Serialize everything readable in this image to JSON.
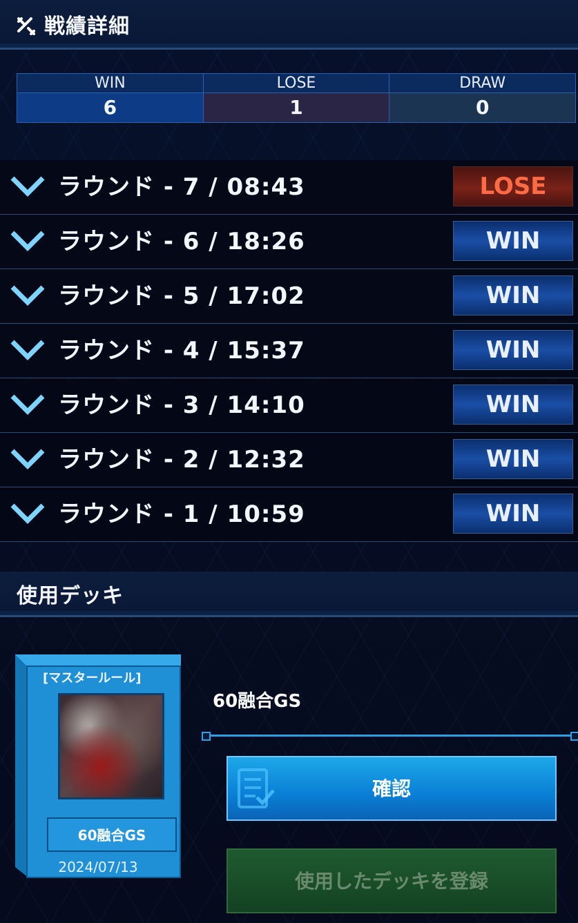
{
  "header": {
    "title": "戦績詳細",
    "icon": "crossed-swords-icon"
  },
  "score": {
    "win_label": "WIN",
    "win_value": "6",
    "lose_label": "LOSE",
    "lose_value": "1",
    "draw_label": "DRAW",
    "draw_value": "0"
  },
  "rounds": [
    {
      "label": "ラウンド - 7 / 08:43",
      "result": "LOSE"
    },
    {
      "label": "ラウンド - 6 / 18:26",
      "result": "WIN"
    },
    {
      "label": "ラウンド - 5 / 17:02",
      "result": "WIN"
    },
    {
      "label": "ラウンド - 4 / 15:37",
      "result": "WIN"
    },
    {
      "label": "ラウンド - 3 / 14:10",
      "result": "WIN"
    },
    {
      "label": "ラウンド - 2 / 12:32",
      "result": "WIN"
    },
    {
      "label": "ラウンド - 1 / 10:59",
      "result": "WIN"
    }
  ],
  "deck_section": {
    "title": "使用デッキ"
  },
  "deck": {
    "rule": "[マスタールール]",
    "name": "60融合GS",
    "date": "2024/07/13",
    "title": "60融合GS"
  },
  "buttons": {
    "confirm": "確認",
    "register": "使用したデッキを登録"
  },
  "colors": {
    "accent": "#1ea8e8",
    "win": "#1a4ea6",
    "lose": "#ff6b45"
  }
}
